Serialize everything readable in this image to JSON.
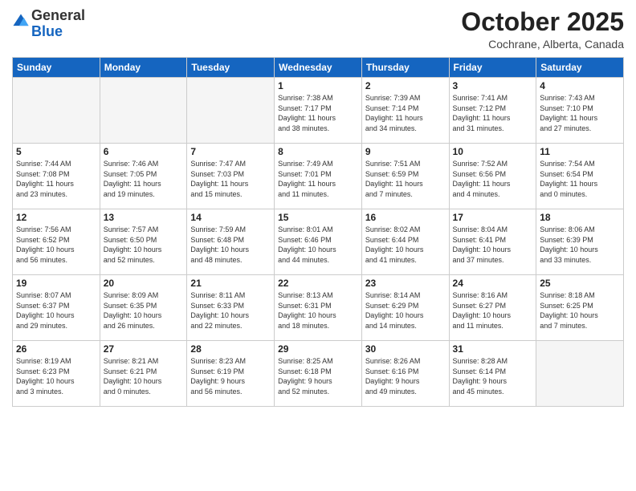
{
  "header": {
    "logo_general": "General",
    "logo_blue": "Blue",
    "month_title": "October 2025",
    "location": "Cochrane, Alberta, Canada"
  },
  "weekdays": [
    "Sunday",
    "Monday",
    "Tuesday",
    "Wednesday",
    "Thursday",
    "Friday",
    "Saturday"
  ],
  "days": [
    {
      "num": "",
      "info": "",
      "empty": true
    },
    {
      "num": "",
      "info": "",
      "empty": true
    },
    {
      "num": "",
      "info": "",
      "empty": true
    },
    {
      "num": "1",
      "info": "Sunrise: 7:38 AM\nSunset: 7:17 PM\nDaylight: 11 hours\nand 38 minutes."
    },
    {
      "num": "2",
      "info": "Sunrise: 7:39 AM\nSunset: 7:14 PM\nDaylight: 11 hours\nand 34 minutes."
    },
    {
      "num": "3",
      "info": "Sunrise: 7:41 AM\nSunset: 7:12 PM\nDaylight: 11 hours\nand 31 minutes."
    },
    {
      "num": "4",
      "info": "Sunrise: 7:43 AM\nSunset: 7:10 PM\nDaylight: 11 hours\nand 27 minutes."
    },
    {
      "num": "5",
      "info": "Sunrise: 7:44 AM\nSunset: 7:08 PM\nDaylight: 11 hours\nand 23 minutes."
    },
    {
      "num": "6",
      "info": "Sunrise: 7:46 AM\nSunset: 7:05 PM\nDaylight: 11 hours\nand 19 minutes."
    },
    {
      "num": "7",
      "info": "Sunrise: 7:47 AM\nSunset: 7:03 PM\nDaylight: 11 hours\nand 15 minutes."
    },
    {
      "num": "8",
      "info": "Sunrise: 7:49 AM\nSunset: 7:01 PM\nDaylight: 11 hours\nand 11 minutes."
    },
    {
      "num": "9",
      "info": "Sunrise: 7:51 AM\nSunset: 6:59 PM\nDaylight: 11 hours\nand 7 minutes."
    },
    {
      "num": "10",
      "info": "Sunrise: 7:52 AM\nSunset: 6:56 PM\nDaylight: 11 hours\nand 4 minutes."
    },
    {
      "num": "11",
      "info": "Sunrise: 7:54 AM\nSunset: 6:54 PM\nDaylight: 11 hours\nand 0 minutes."
    },
    {
      "num": "12",
      "info": "Sunrise: 7:56 AM\nSunset: 6:52 PM\nDaylight: 10 hours\nand 56 minutes."
    },
    {
      "num": "13",
      "info": "Sunrise: 7:57 AM\nSunset: 6:50 PM\nDaylight: 10 hours\nand 52 minutes."
    },
    {
      "num": "14",
      "info": "Sunrise: 7:59 AM\nSunset: 6:48 PM\nDaylight: 10 hours\nand 48 minutes."
    },
    {
      "num": "15",
      "info": "Sunrise: 8:01 AM\nSunset: 6:46 PM\nDaylight: 10 hours\nand 44 minutes."
    },
    {
      "num": "16",
      "info": "Sunrise: 8:02 AM\nSunset: 6:44 PM\nDaylight: 10 hours\nand 41 minutes."
    },
    {
      "num": "17",
      "info": "Sunrise: 8:04 AM\nSunset: 6:41 PM\nDaylight: 10 hours\nand 37 minutes."
    },
    {
      "num": "18",
      "info": "Sunrise: 8:06 AM\nSunset: 6:39 PM\nDaylight: 10 hours\nand 33 minutes."
    },
    {
      "num": "19",
      "info": "Sunrise: 8:07 AM\nSunset: 6:37 PM\nDaylight: 10 hours\nand 29 minutes."
    },
    {
      "num": "20",
      "info": "Sunrise: 8:09 AM\nSunset: 6:35 PM\nDaylight: 10 hours\nand 26 minutes."
    },
    {
      "num": "21",
      "info": "Sunrise: 8:11 AM\nSunset: 6:33 PM\nDaylight: 10 hours\nand 22 minutes."
    },
    {
      "num": "22",
      "info": "Sunrise: 8:13 AM\nSunset: 6:31 PM\nDaylight: 10 hours\nand 18 minutes."
    },
    {
      "num": "23",
      "info": "Sunrise: 8:14 AM\nSunset: 6:29 PM\nDaylight: 10 hours\nand 14 minutes."
    },
    {
      "num": "24",
      "info": "Sunrise: 8:16 AM\nSunset: 6:27 PM\nDaylight: 10 hours\nand 11 minutes."
    },
    {
      "num": "25",
      "info": "Sunrise: 8:18 AM\nSunset: 6:25 PM\nDaylight: 10 hours\nand 7 minutes."
    },
    {
      "num": "26",
      "info": "Sunrise: 8:19 AM\nSunset: 6:23 PM\nDaylight: 10 hours\nand 3 minutes."
    },
    {
      "num": "27",
      "info": "Sunrise: 8:21 AM\nSunset: 6:21 PM\nDaylight: 10 hours\nand 0 minutes."
    },
    {
      "num": "28",
      "info": "Sunrise: 8:23 AM\nSunset: 6:19 PM\nDaylight: 9 hours\nand 56 minutes."
    },
    {
      "num": "29",
      "info": "Sunrise: 8:25 AM\nSunset: 6:18 PM\nDaylight: 9 hours\nand 52 minutes."
    },
    {
      "num": "30",
      "info": "Sunrise: 8:26 AM\nSunset: 6:16 PM\nDaylight: 9 hours\nand 49 minutes."
    },
    {
      "num": "31",
      "info": "Sunrise: 8:28 AM\nSunset: 6:14 PM\nDaylight: 9 hours\nand 45 minutes."
    },
    {
      "num": "",
      "info": "",
      "empty": true
    },
    {
      "num": "",
      "info": "",
      "empty": true
    },
    {
      "num": "",
      "info": "",
      "empty": true
    },
    {
      "num": "",
      "info": "",
      "empty": true
    },
    {
      "num": "",
      "info": "",
      "empty": true
    },
    {
      "num": "",
      "info": "",
      "empty": true
    }
  ]
}
